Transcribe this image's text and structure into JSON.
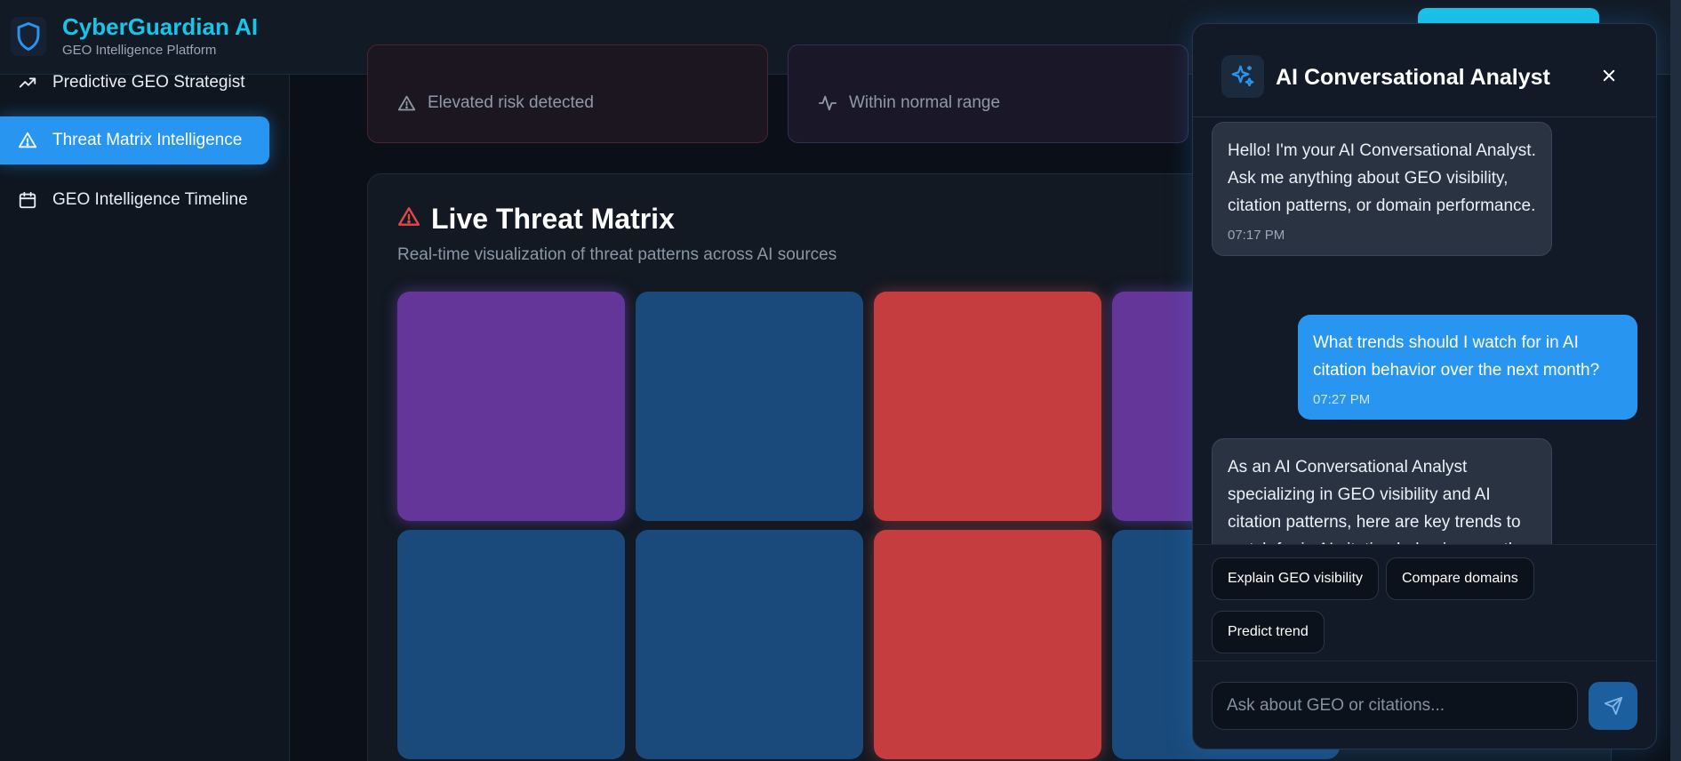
{
  "brand": {
    "title": "CyberGuardian AI",
    "subtitle": "GEO Intelligence Platform"
  },
  "sidebar": {
    "items": [
      {
        "label": "Predictive GEO Strategist",
        "icon": "trending-up-icon",
        "active": false
      },
      {
        "label": "Threat Matrix Intelligence",
        "icon": "alert-triangle-icon",
        "active": true
      },
      {
        "label": "GEO Intelligence Timeline",
        "icon": "calendar-icon",
        "active": false
      }
    ]
  },
  "stats": [
    {
      "text": "Elevated risk detected",
      "icon": "alert-triangle-icon"
    },
    {
      "text": "Within normal range",
      "icon": "activity-icon"
    }
  ],
  "matrix": {
    "title": "Live Threat Matrix",
    "subtitle": "Real-time visualization of threat patterns across AI sources",
    "rows": [
      [
        "purple",
        "blue",
        "red",
        "purple"
      ],
      [
        "blue",
        "blue",
        "red",
        "blue"
      ]
    ],
    "colors": {
      "purple": "#65369a",
      "blue": "#1a4a7c",
      "red": "#c63d3f"
    }
  },
  "chat": {
    "title": "AI Conversational Analyst",
    "messages": [
      {
        "role": "ai",
        "text": "Hello! I'm your AI Conversational Analyst. Ask me anything about GEO visibility, citation patterns, or domain performance.",
        "time": "07:17 PM"
      },
      {
        "role": "user",
        "text": "What trends should I watch for in AI citation behavior over the next month?",
        "time": "07:27 PM"
      },
      {
        "role": "ai",
        "text": "As an AI Conversational Analyst specializing in GEO visibility and AI citation patterns, here are key trends to watch for in AI citation behavior over the",
        "time": ""
      }
    ],
    "quick_actions": [
      "Explain GEO visibility",
      "Compare domains",
      "Predict trend"
    ],
    "input_placeholder": "Ask about GEO or citations..."
  },
  "colors": {
    "accent": "#2896f0",
    "brand": "#18c4e8",
    "danger": "#e0484a"
  }
}
